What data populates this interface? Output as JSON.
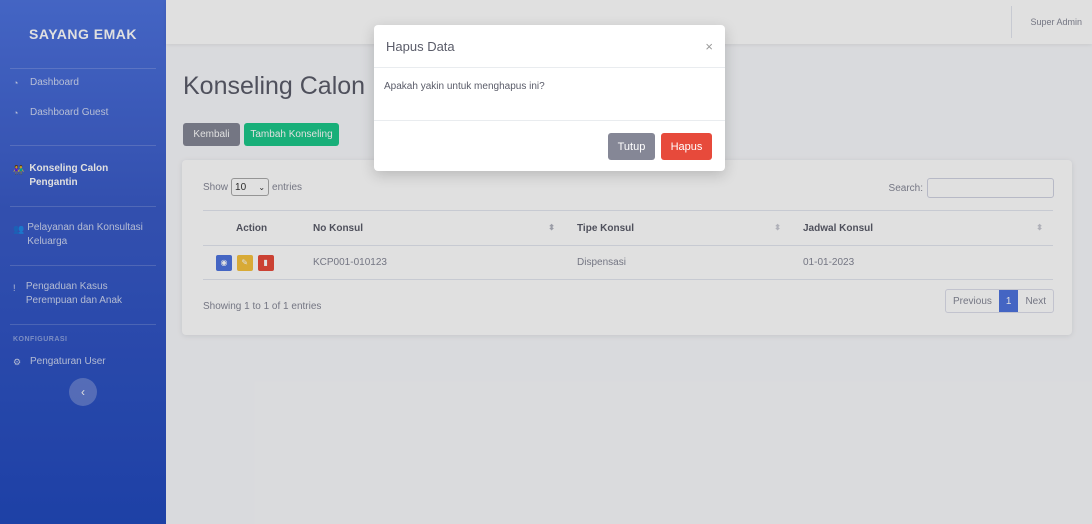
{
  "sidebar": {
    "brand": "SAYANG EMAK",
    "items": [
      {
        "icon": "gauge-icon",
        "label": "Dashboard"
      },
      {
        "icon": "gauge-icon",
        "label": "Dashboard Guest"
      },
      {
        "icon": "couple-icon",
        "label": "Konseling Calon Pengantin"
      },
      {
        "icon": "users-icon",
        "label": "Pelayanan dan Konsultasi Keluarga"
      },
      {
        "icon": "exclamation-icon",
        "label": "Pengaduan Kasus Perempuan dan Anak"
      }
    ],
    "heading": "KONFIGURASI",
    "config_item": {
      "icon": "gears-icon",
      "label": "Pengaturan User"
    },
    "toggle_glyph": "‹"
  },
  "topbar": {
    "user": "Super Admin"
  },
  "page": {
    "title": "Konseling Calon Pengantin",
    "back_label": "Kembali",
    "add_label": "Tambah Konseling"
  },
  "table": {
    "show_prefix": "Show",
    "show_value": "10",
    "show_suffix": "entries",
    "search_label": "Search:",
    "headers": [
      "Action",
      "No Konsul",
      "Tipe Konsul",
      "Jadwal Konsul"
    ],
    "rows": [
      {
        "no_konsul": "KCP001-010123",
        "tipe": "Dispensasi",
        "jadwal": "01-01-2023"
      }
    ],
    "info": "Showing 1 to 1 of 1 entries",
    "prev": "Previous",
    "page": "1",
    "next": "Next"
  },
  "modal": {
    "title": "Hapus Data",
    "close_glyph": "×",
    "body": "Apakah yakin untuk menghapus ini?",
    "close_label": "Tutup",
    "delete_label": "Hapus"
  },
  "colors": {
    "primary": "#4e73df",
    "success": "#1cc88a",
    "danger": "#e74a3b",
    "warning": "#f6c23e",
    "secondary": "#858796"
  }
}
